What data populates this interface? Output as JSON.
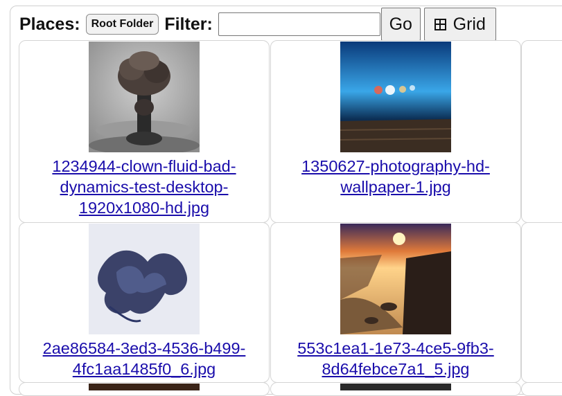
{
  "toolbar": {
    "places_label": "Places:",
    "root_folder_label": "Root Folder",
    "filter_label": "Filter:",
    "filter_value": "",
    "go_label": "Go",
    "grid_label": "Grid"
  },
  "icons": {
    "grid": "grid-icon"
  },
  "files": [
    {
      "name": "1234944-clown-fluid-bad-dynamics-test-desktop-1920x1080-hd.jpg"
    },
    {
      "name": "1350627-photography-hd-wallpaper-1.jpg"
    },
    {
      "name": "2ae86584-3ed3-4536-b499-4fc1aa1485f0_6.jpg"
    },
    {
      "name": "553c1ea1-1e73-4ce5-9fb3-8d64febce7a1_5.jpg"
    }
  ],
  "colors": {
    "link": "#1a0dab",
    "card_border": "#d4d4d4"
  }
}
